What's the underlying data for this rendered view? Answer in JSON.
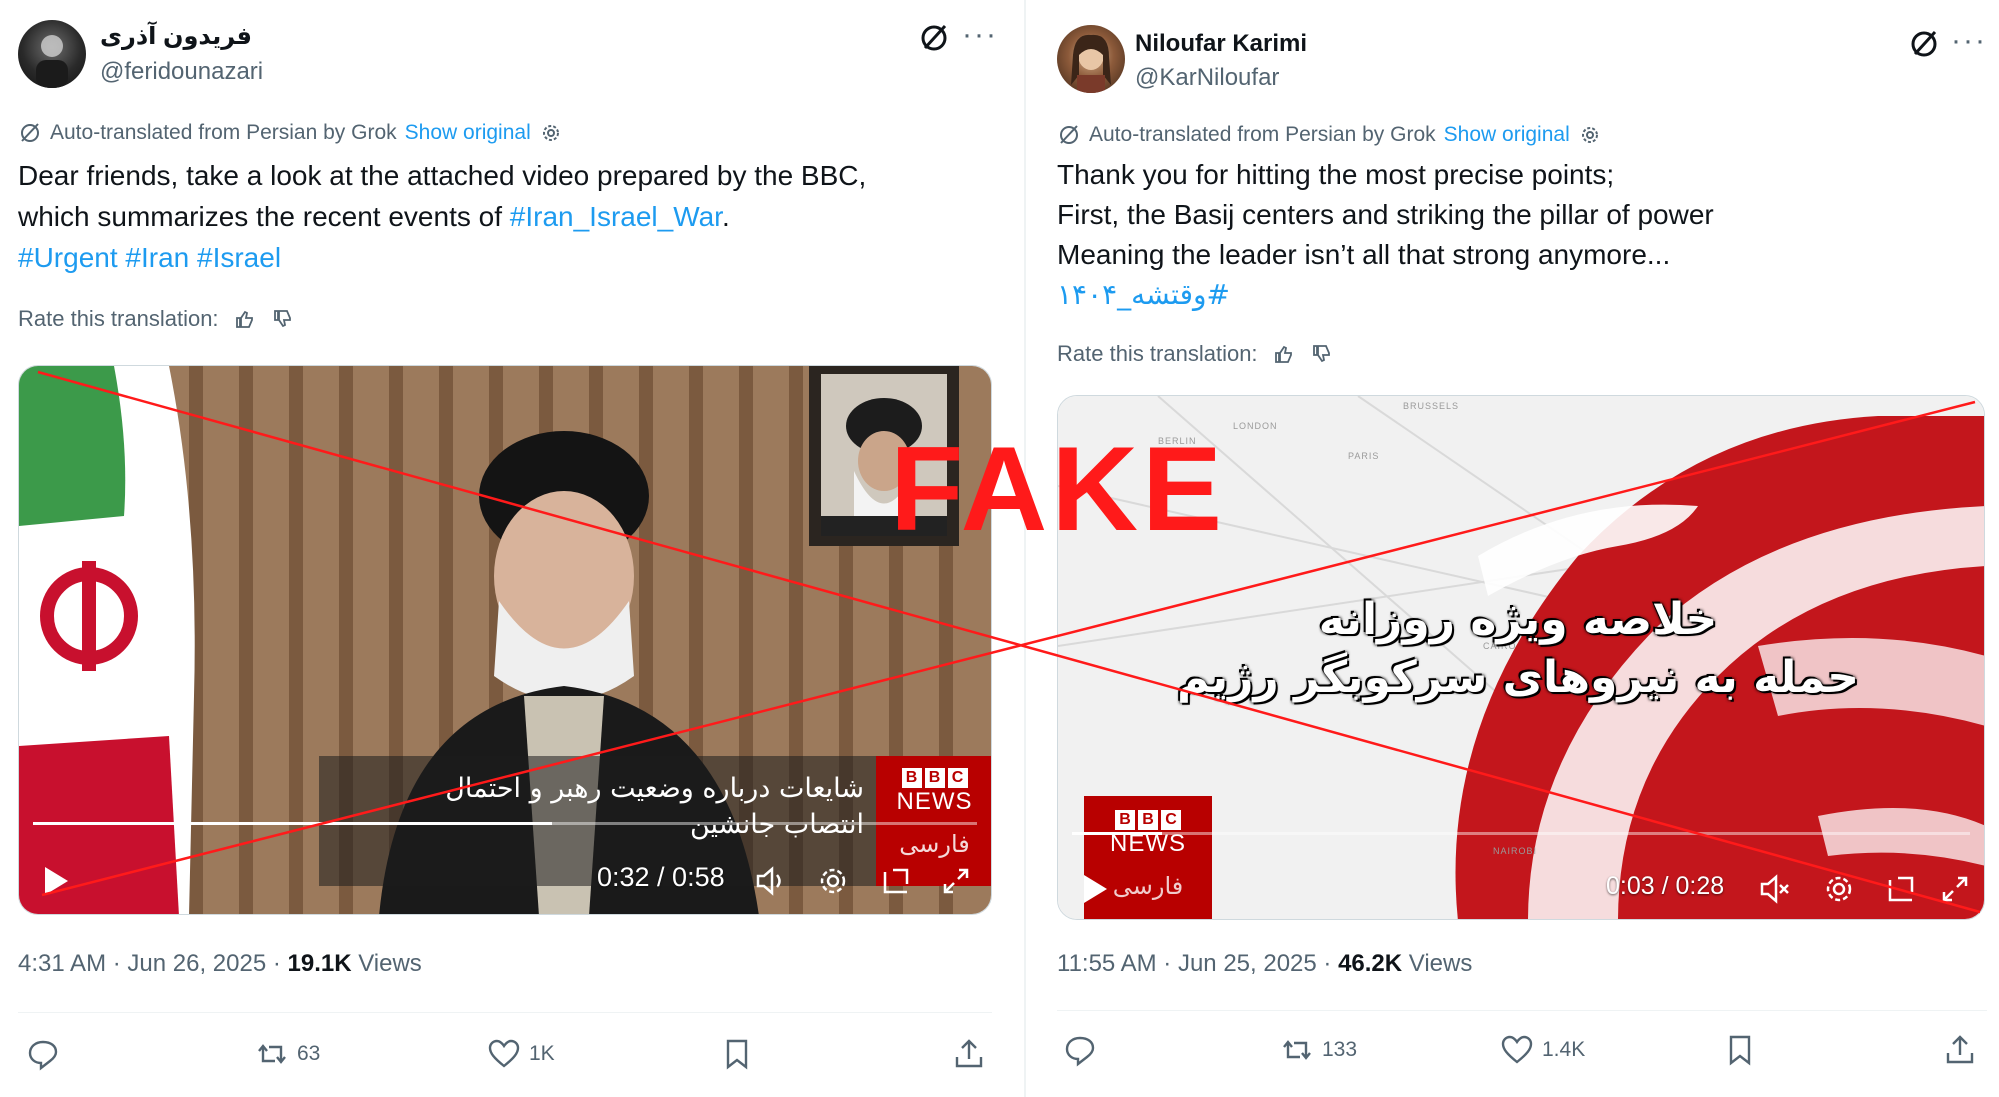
{
  "overlay": {
    "stamp_text": "FAKE",
    "stamp_color": "#ff1a1a"
  },
  "colors": {
    "link": "#1d9bf0",
    "muted": "#536471",
    "text": "#0f1419",
    "bbc_red": "#b80000"
  },
  "posts": [
    {
      "author": {
        "display_name": "فریدون آذری",
        "handle": "@feridounazari"
      },
      "autotranslate": {
        "text": "Auto-translated from Persian by Grok",
        "show_original": "Show original"
      },
      "text_lines": [
        "Dear friends, take a look at the attached video prepared by the BBC,",
        "which summarizes the recent events of "
      ],
      "inline_hashtag": "#Iran_Israel_War",
      "inline_suffix": ".",
      "hashtags_line": "#Urgent #Iran #Israel",
      "rate_label": "Rate this translation:",
      "video": {
        "caption_line1": "شایعات درباره وضعیت رهبر و احتمال",
        "caption_line2": "انتصاب جانشین",
        "time": "0:32 / 0:58",
        "progress": 0.55,
        "bbc_letters": [
          "B",
          "B",
          "C"
        ],
        "bbc_news": "NEWS",
        "bbc_farsi": "فارسی"
      },
      "timestamp": "4:31 AM · Jun 26, 2025 · ",
      "views_count": "19.1K",
      "views_label": " Views",
      "actions": {
        "replies": "",
        "reposts": "63",
        "likes": "1K"
      }
    },
    {
      "author": {
        "display_name": "Niloufar Karimi",
        "handle": "@KarNiloufar"
      },
      "autotranslate": {
        "text": "Auto-translated from Persian by Grok",
        "show_original": "Show original"
      },
      "text_lines": [
        "Thank you for hitting the most precise points;",
        "First, the Basij centers and striking the pillar of power",
        "Meaning the leader isn’t all that strong anymore..."
      ],
      "hashtags_line": "#وقتشه_۱۴۰۴",
      "rate_label": "Rate this translation:",
      "video": {
        "title_line1": "خلاصه ویژه روزانه",
        "title_line2": "حمله به نیروهای سرکوبگر رژیم",
        "map_labels": [
          "LONDON",
          "BRUSSELS",
          "PARIS",
          "BERLIN",
          "NAIROBI",
          "CAIRO"
        ],
        "time": "0:03 / 0:28",
        "progress": 0.1,
        "bbc_letters": [
          "B",
          "B",
          "C"
        ],
        "bbc_news": "NEWS",
        "bbc_farsi": "فارسی"
      },
      "timestamp": "11:55 AM · Jun 25, 2025 · ",
      "views_count": "46.2K",
      "views_label": " Views",
      "actions": {
        "replies": "",
        "reposts": "133",
        "likes": "1.4K"
      }
    }
  ]
}
